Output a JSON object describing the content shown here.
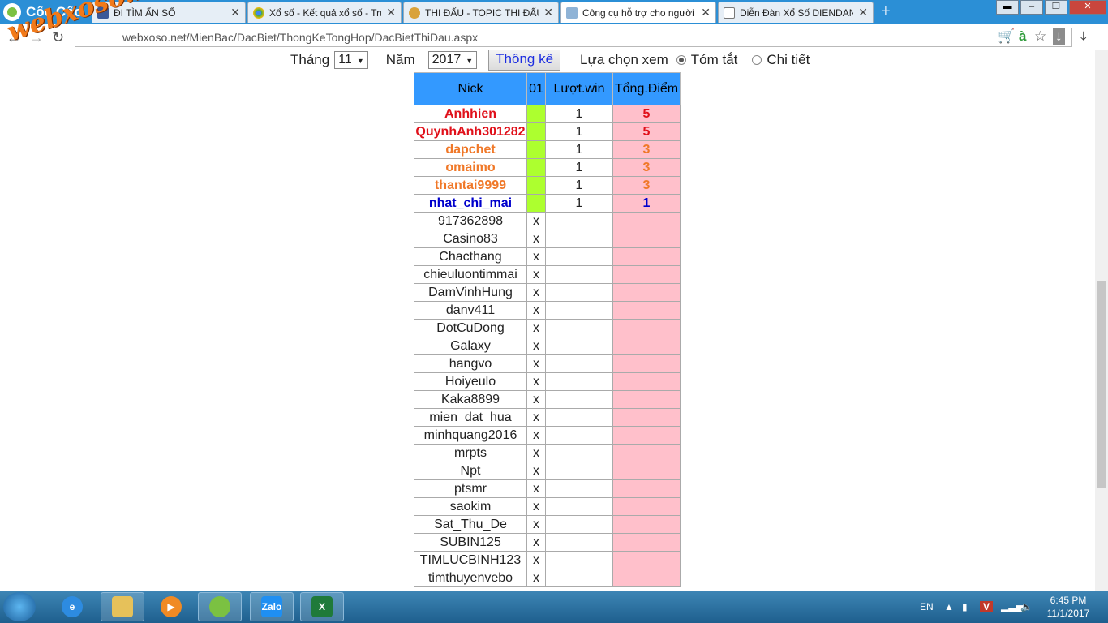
{
  "browser": {
    "name": "Cốc Cốc",
    "tabs": [
      {
        "title": "ĐI TÌM ẨN SỐ",
        "icon": "facebook-icon",
        "active": false
      },
      {
        "title": "Xổ số - Kết quả xổ số - Trự",
        "icon": "chrome-icon",
        "active": false
      },
      {
        "title": "THI ĐẤU - TOPIC THI ĐẤU",
        "icon": "xs-icon",
        "active": false
      },
      {
        "title": "Công cụ hỗ trợ cho người",
        "icon": "page-icon",
        "active": true
      },
      {
        "title": "Diễn Đàn Xổ Số DIENDAN",
        "icon": "doc-icon",
        "active": false
      }
    ],
    "url_scheme": "webxoso.net/",
    "url_path": "MienBac/DacBiet/ThongKeTongHop/DacBietThiDau.aspx"
  },
  "watermark": "webxoso.net",
  "filters": {
    "month_label": "Tháng",
    "month_value": "11",
    "year_label": "Năm",
    "year_value": "2017",
    "submit_label": "Thông kê",
    "view_label": "Lựa chọn xem",
    "option_summary": "Tóm tắt",
    "option_detail": "Chi tiết"
  },
  "table": {
    "headers": [
      "Nick",
      "01",
      "Lượt.win",
      "Tổng.Điểm"
    ],
    "rows": [
      {
        "nick": "Anhhien",
        "mark": "",
        "wins": "1",
        "points": "5",
        "style": "red"
      },
      {
        "nick": "QuynhAnh301282",
        "mark": "",
        "wins": "1",
        "points": "5",
        "style": "red"
      },
      {
        "nick": "dapchet",
        "mark": "",
        "wins": "1",
        "points": "3",
        "style": "org"
      },
      {
        "nick": "omaimo",
        "mark": "",
        "wins": "1",
        "points": "3",
        "style": "org"
      },
      {
        "nick": "thantai9999",
        "mark": "",
        "wins": "1",
        "points": "3",
        "style": "org"
      },
      {
        "nick": "nhat_chi_mai",
        "mark": "",
        "wins": "1",
        "points": "1",
        "style": "blu"
      },
      {
        "nick": "917362898",
        "mark": "x",
        "wins": "",
        "points": "",
        "style": ""
      },
      {
        "nick": "Casino83",
        "mark": "x",
        "wins": "",
        "points": "",
        "style": ""
      },
      {
        "nick": "Chacthang",
        "mark": "x",
        "wins": "",
        "points": "",
        "style": ""
      },
      {
        "nick": "chieuluontimmai",
        "mark": "x",
        "wins": "",
        "points": "",
        "style": ""
      },
      {
        "nick": "DamVinhHung",
        "mark": "x",
        "wins": "",
        "points": "",
        "style": ""
      },
      {
        "nick": "danv411",
        "mark": "x",
        "wins": "",
        "points": "",
        "style": ""
      },
      {
        "nick": "DotCuDong",
        "mark": "x",
        "wins": "",
        "points": "",
        "style": ""
      },
      {
        "nick": "Galaxy",
        "mark": "x",
        "wins": "",
        "points": "",
        "style": ""
      },
      {
        "nick": "hangvo",
        "mark": "x",
        "wins": "",
        "points": "",
        "style": ""
      },
      {
        "nick": "Hoiyeulo",
        "mark": "x",
        "wins": "",
        "points": "",
        "style": ""
      },
      {
        "nick": "Kaka8899",
        "mark": "x",
        "wins": "",
        "points": "",
        "style": ""
      },
      {
        "nick": "mien_dat_hua",
        "mark": "x",
        "wins": "",
        "points": "",
        "style": ""
      },
      {
        "nick": "minhquang2016",
        "mark": "x",
        "wins": "",
        "points": "",
        "style": ""
      },
      {
        "nick": "mrpts",
        "mark": "x",
        "wins": "",
        "points": "",
        "style": ""
      },
      {
        "nick": "Npt",
        "mark": "x",
        "wins": "",
        "points": "",
        "style": ""
      },
      {
        "nick": "ptsmr",
        "mark": "x",
        "wins": "",
        "points": "",
        "style": ""
      },
      {
        "nick": "saokim",
        "mark": "x",
        "wins": "",
        "points": "",
        "style": ""
      },
      {
        "nick": "Sat_Thu_De",
        "mark": "x",
        "wins": "",
        "points": "",
        "style": ""
      },
      {
        "nick": "SUBIN125",
        "mark": "x",
        "wins": "",
        "points": "",
        "style": ""
      },
      {
        "nick": "TIMLUCBINH123",
        "mark": "x",
        "wins": "",
        "points": "",
        "style": ""
      },
      {
        "nick": "timthuyenvebo",
        "mark": "x",
        "wins": "",
        "points": "",
        "style": ""
      }
    ]
  },
  "taskbar": {
    "apps": [
      "internet-explorer-icon",
      "file-explorer-icon",
      "media-player-icon",
      "coccoc-icon",
      "zalo-icon",
      "excel-icon"
    ],
    "zalo_label": "Zalo",
    "language": "EN",
    "time": "6:45 PM",
    "date": "11/1/2017"
  }
}
